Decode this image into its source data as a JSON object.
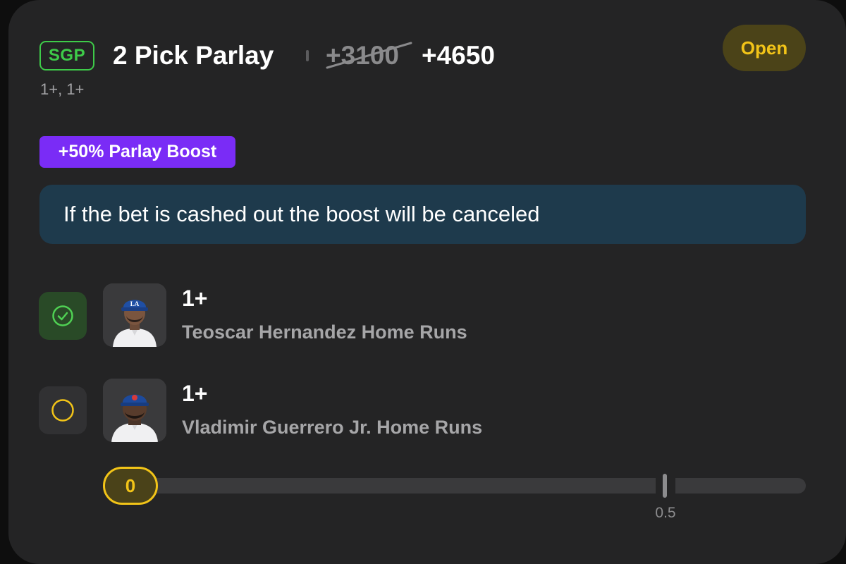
{
  "header": {
    "badge": "SGP",
    "title": "2 Pick Parlay",
    "original_odds": "+3100",
    "boosted_odds": "+4650",
    "status": "Open",
    "subtitle": "1+, 1+"
  },
  "boost": {
    "label": "+50% Parlay Boost",
    "notice": "If the bet is cashed out the boost will be canceled"
  },
  "legs": [
    {
      "line": "1+",
      "market": "Teoscar Hernandez Home Runs",
      "status": "won",
      "status_icon": "check-circle-icon",
      "avatar_icon": "player-headshot-dodgers"
    },
    {
      "line": "1+",
      "market": "Vladimir Guerrero Jr. Home Runs",
      "status": "open",
      "status_icon": "open-circle-icon",
      "avatar_icon": "player-headshot-blue-jays"
    }
  ],
  "progress": {
    "current": "0",
    "target_label": "0.5",
    "current_value": 0,
    "target_value": 0.5
  },
  "colors": {
    "card_bg": "#242425",
    "sgp_green": "#3ecb49",
    "status_yellow": "#f2c418",
    "boost_purple": "#7a2cf6",
    "notice_bg": "#1e3a4c",
    "won_bg": "#294a27"
  }
}
